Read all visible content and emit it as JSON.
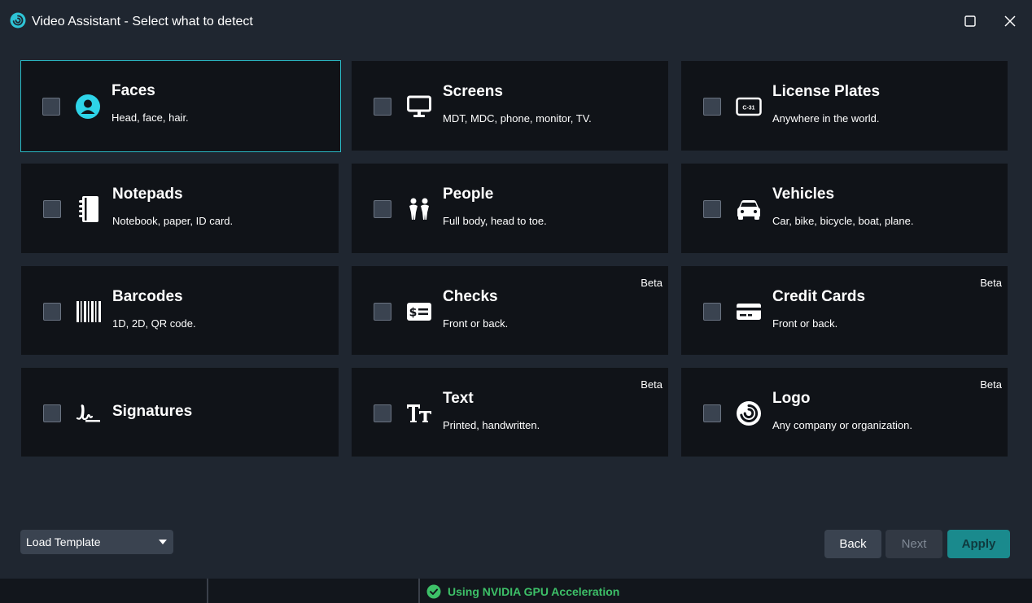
{
  "window": {
    "title": "Video Assistant - Select what to detect",
    "app_icon": "spiral-logo-icon",
    "accent_color": "#2ab8c4"
  },
  "categories": [
    {
      "title": "Faces",
      "subtitle": "Head, face, hair.",
      "icon": "face-icon",
      "beta": "",
      "selected": true
    },
    {
      "title": "Screens",
      "subtitle": "MDT, MDC, phone, monitor, TV.",
      "icon": "monitor-icon",
      "beta": ""
    },
    {
      "title": "License Plates",
      "subtitle": "Anywhere in the world.",
      "icon": "license-plate-icon",
      "plate_text": "C-31",
      "beta": ""
    },
    {
      "title": "Notepads",
      "subtitle": "Notebook, paper, ID card.",
      "icon": "notepad-icon",
      "beta": ""
    },
    {
      "title": "People",
      "subtitle": "Full body, head to toe.",
      "icon": "people-icon",
      "beta": ""
    },
    {
      "title": "Vehicles",
      "subtitle": "Car, bike, bicycle, boat, plane.",
      "icon": "car-icon",
      "beta": ""
    },
    {
      "title": "Barcodes",
      "subtitle": "1D, 2D, QR code.",
      "icon": "barcode-icon",
      "beta": ""
    },
    {
      "title": "Checks",
      "subtitle": "Front or back.",
      "icon": "check-icon",
      "beta": "Beta"
    },
    {
      "title": "Credit Cards",
      "subtitle": "Front or back.",
      "icon": "credit-card-icon",
      "beta": "Beta"
    },
    {
      "title": "Signatures",
      "subtitle": "",
      "icon": "signature-icon",
      "beta": ""
    },
    {
      "title": "Text",
      "subtitle": "Printed, handwritten.",
      "icon": "text-icon",
      "beta": "Beta"
    },
    {
      "title": "Logo",
      "subtitle": "Any company or organization.",
      "icon": "logo-icon",
      "beta": "Beta"
    }
  ],
  "footer": {
    "load_template": "Load Template",
    "back": "Back",
    "next": "Next",
    "apply": "Apply"
  },
  "status": {
    "gpu": "Using NVIDIA GPU Acceleration",
    "ok_color": "#3dc068"
  }
}
